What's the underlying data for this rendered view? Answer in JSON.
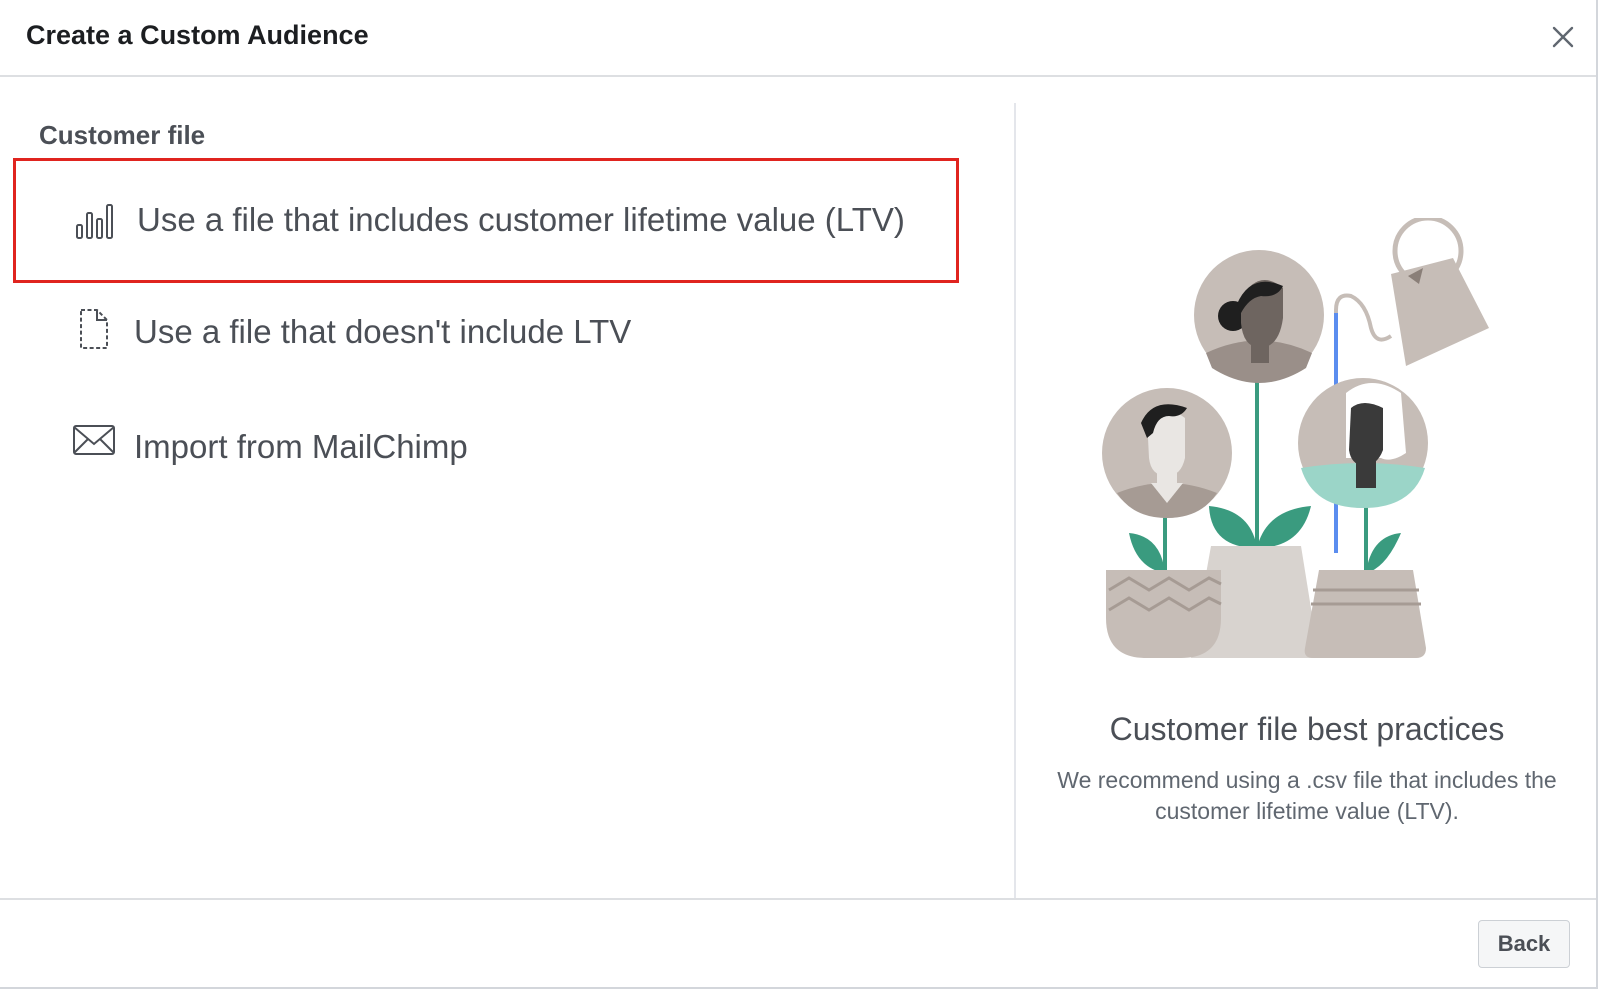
{
  "dialog": {
    "title": "Create a Custom Audience"
  },
  "left_panel": {
    "section_title": "Customer file",
    "options": [
      {
        "label": "Use a file that includes customer lifetime value (LTV)",
        "icon": "bar-chart-icon",
        "highlighted": true
      },
      {
        "label": "Use a file that doesn't include LTV",
        "icon": "document-icon",
        "highlighted": false
      },
      {
        "label": "Import from MailChimp",
        "icon": "envelope-icon",
        "highlighted": false
      }
    ]
  },
  "right_panel": {
    "title": "Customer file best practices",
    "description": "We recommend using a .csv file that includes the customer lifetime value (LTV)."
  },
  "footer": {
    "back_label": "Back"
  },
  "colors": {
    "highlight_border": "#e0241f",
    "text_primary": "#1c1e21",
    "text_secondary": "#4b4f56",
    "leaf_green": "#3a9b7f",
    "pot_gray": "#c6bdb7"
  }
}
